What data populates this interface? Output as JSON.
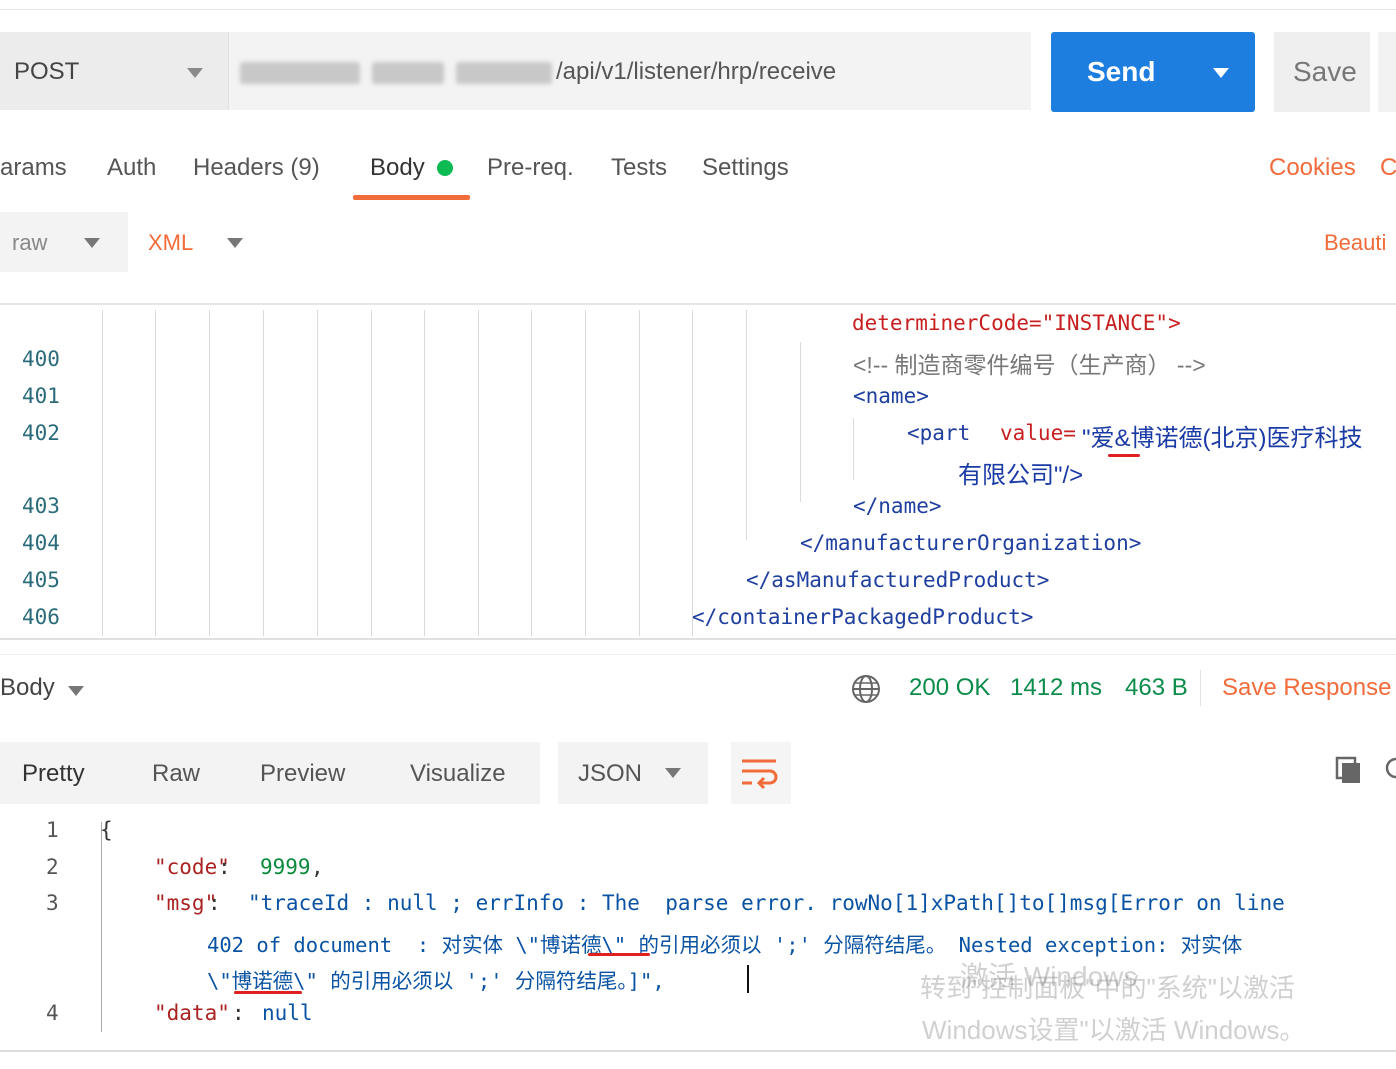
{
  "request": {
    "method": "POST",
    "url_path": "/api/v1/listener/hrp/receive",
    "send_label": "Send",
    "save_label": "Save"
  },
  "request_tabs": {
    "params": "arams",
    "auth": "Auth",
    "headers": "Headers (9)",
    "body": "Body",
    "prereq": "Pre-req.",
    "tests": "Tests",
    "settings": "Settings",
    "cookies": "Cookies",
    "cut": "C"
  },
  "body_options": {
    "mode": "raw",
    "format": "XML",
    "beautify": "Beauti"
  },
  "editor": {
    "line_numbers": [
      "400",
      "401",
      "402",
      "403",
      "404",
      "405",
      "406"
    ],
    "line_0": "determinerCode=\"INSTANCE\">",
    "line_400": "<!-- 制造商零件编号（生产商） -->",
    "line_401": "<name>",
    "line_402_a": "<part",
    "line_402_attr": "value=",
    "line_402_val": "\"爱&博诺德(北京)医疗科技",
    "line_402_cont": "有限公司\"/>",
    "line_403": "</name>",
    "line_404": "</manufacturerOrganization>",
    "line_405": "</asManufacturedProduct>",
    "line_406": "</containerPackagedProduct>"
  },
  "response": {
    "section_label": "Body",
    "status": "200 OK",
    "time": "1412 ms",
    "size": "463 B",
    "save_response": "Save Response",
    "tabs": {
      "pretty": "Pretty",
      "raw": "Raw",
      "preview": "Preview",
      "visualize": "Visualize",
      "format": "JSON"
    },
    "line_numbers": [
      "1",
      "2",
      "3",
      "4"
    ],
    "line_1": "{",
    "code_key": "\"code\"",
    "code_val": "9999",
    "msg_key": "\"msg\"",
    "msg_line1": "\"traceId : null ; errInfo : The  parse error. rowNo[1]xPath[]to[]msg[Error on line",
    "msg_line2": "402 of document  : 对实体 \\\"博诺德\\\" 的引用必须以 ';' 分隔符结尾。 Nested exception: 对实体",
    "msg_line3": "\\\"博诺德\\\" 的引用必须以 ';' 分隔符结尾。]\",",
    "data_key": "\"data\"",
    "data_val": "null"
  },
  "watermark": {
    "line1": "激活 Windows",
    "line2": "转到\"控制面板\"中的\"系统\"以激活",
    "line3": "Windows设置\"以激活 Windows。"
  }
}
